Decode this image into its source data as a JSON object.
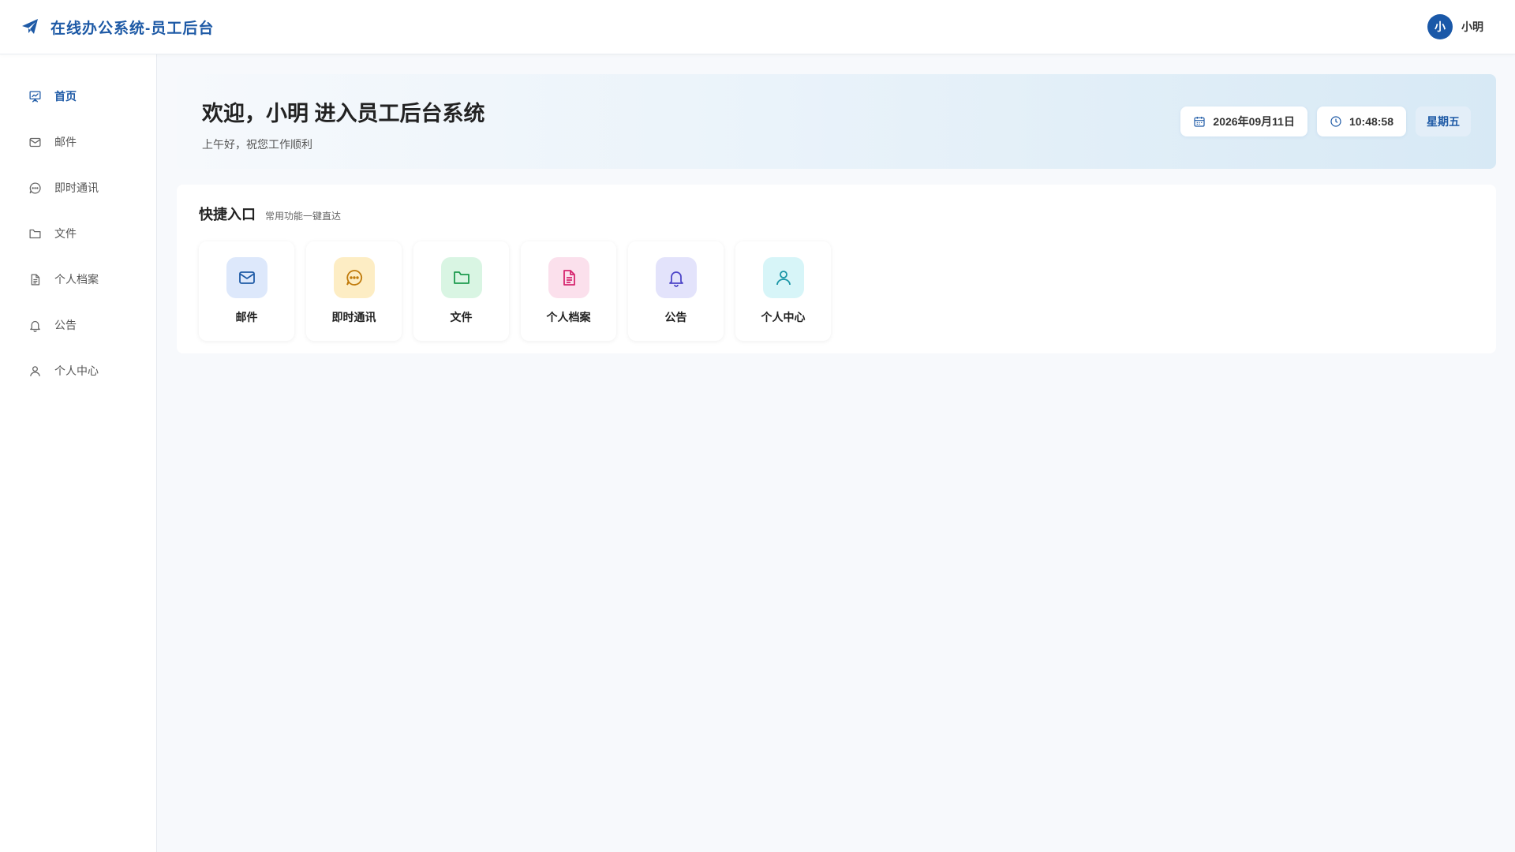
{
  "header": {
    "app_title": "在线办公系统-员工后台",
    "logo_icon": "paper-plane-icon",
    "user": {
      "avatar_text": "小",
      "name": "小明"
    }
  },
  "colors": {
    "brand": "#1e5aa6",
    "page_bg": "#f7f9fc"
  },
  "sidebar": {
    "items": [
      {
        "label": "首页",
        "icon": "presentation-icon",
        "active": true
      },
      {
        "label": "邮件",
        "icon": "mail-icon",
        "active": false
      },
      {
        "label": "即时通讯",
        "icon": "chat-icon",
        "active": false
      },
      {
        "label": "文件",
        "icon": "folder-icon",
        "active": false
      },
      {
        "label": "个人档案",
        "icon": "document-icon",
        "active": false
      },
      {
        "label": "公告",
        "icon": "bell-icon",
        "active": false
      },
      {
        "label": "个人中心",
        "icon": "user-icon",
        "active": false
      }
    ]
  },
  "welcome": {
    "title": "欢迎，小明 进入员工后台系统",
    "subtitle": "上午好，祝您工作顺利",
    "date": "2026年09月11日",
    "time": "10:48:58",
    "weekday": "星期五"
  },
  "quick": {
    "title": "快捷入口",
    "subtitle": "常用功能一键直达",
    "tiles": [
      {
        "label": "邮件",
        "icon": "mail-icon",
        "bg": "#dde8fb",
        "color": "#1e5aa6"
      },
      {
        "label": "即时通讯",
        "icon": "chat-icon",
        "bg": "#fdedc4",
        "color": "#c07a0a"
      },
      {
        "label": "文件",
        "icon": "folder-icon",
        "bg": "#d9f5e3",
        "color": "#1d9a4e"
      },
      {
        "label": "个人档案",
        "icon": "document-icon",
        "bg": "#fbe0ec",
        "color": "#d6266f"
      },
      {
        "label": "公告",
        "icon": "bell-icon",
        "bg": "#e3e3fb",
        "color": "#4e46c8"
      },
      {
        "label": "个人中心",
        "icon": "user-icon",
        "bg": "#d7f5f8",
        "color": "#1995a6"
      }
    ]
  }
}
